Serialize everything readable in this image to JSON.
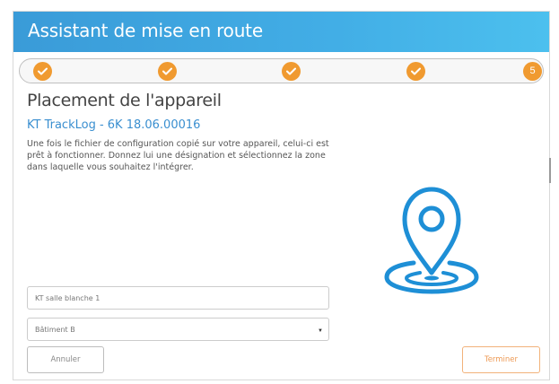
{
  "header": {
    "title": "Assistant de mise en route"
  },
  "stepper": {
    "steps": [
      {
        "state": "done",
        "icon": "checkmark-icon"
      },
      {
        "state": "done",
        "icon": "checkmark-icon"
      },
      {
        "state": "done",
        "icon": "checkmark-icon"
      },
      {
        "state": "done",
        "icon": "checkmark-icon"
      },
      {
        "state": "current",
        "label": "5"
      }
    ]
  },
  "content": {
    "title": "Placement de l'appareil",
    "device": "KT TrackLog - 6K 18.06.00016",
    "description": "Une fois le fichier de configuration copié sur votre appareil, celui-ci est prêt à fonctionner. Donnez lui une désignation et sélectionnez la zone dans laquelle vous souhaitez l'intégrer."
  },
  "form": {
    "name_value": "KT salle blanche 1",
    "zone_value": "Bâtiment B"
  },
  "buttons": {
    "cancel": "Annuler",
    "finish": "Terminer"
  },
  "colors": {
    "header": "#42aee6",
    "step": "#f09a30",
    "accent_blue": "#1e8fd6",
    "finish_border": "#f2b27a"
  },
  "illustration": {
    "icon": "location-pin-icon"
  }
}
